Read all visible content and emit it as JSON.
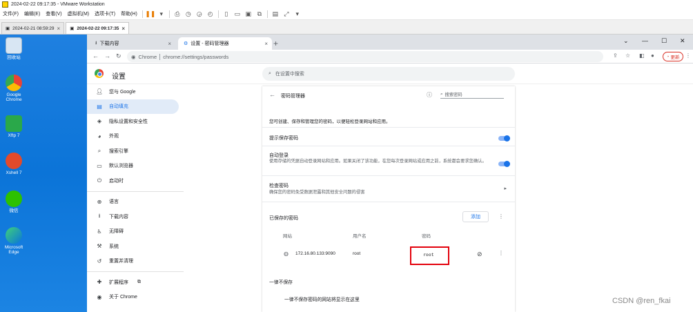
{
  "vm": {
    "title": "2024-02-22 09:17:35 - VMware Workstation",
    "menu": [
      "文件(F)",
      "编辑(E)",
      "查看(V)",
      "虚拟机(M)",
      "选项卡(T)",
      "帮助(H)"
    ],
    "tabs": [
      "2024-02-21 08:59:29",
      "2024-02-22 09:17:35"
    ]
  },
  "desktop": {
    "icons": [
      "回收站",
      "Google Chrome",
      "Xftp 7",
      "Xshell 7",
      "微信",
      "Microsoft Edge"
    ]
  },
  "chrome": {
    "tabs": [
      "下载内容",
      "设置 - 密码管理器"
    ],
    "address_label": "Chrome",
    "url": "chrome://settings/passwords",
    "update_label": "更新"
  },
  "settings": {
    "title": "设置",
    "search_placeholder": "在设置中搜索",
    "sidebar": [
      {
        "label": "您与 Google",
        "icon": "person-icon"
      },
      {
        "label": "自动填充",
        "icon": "autofill-icon"
      },
      {
        "label": "隐私设置和安全性",
        "icon": "shield-icon"
      },
      {
        "label": "外观",
        "icon": "palette-icon"
      },
      {
        "label": "搜索引擎",
        "icon": "search-icon"
      },
      {
        "label": "默认浏览器",
        "icon": "browser-icon"
      },
      {
        "label": "启动时",
        "icon": "power-icon"
      },
      {
        "label": "语言",
        "icon": "globe-icon"
      },
      {
        "label": "下载内容",
        "icon": "download-icon"
      },
      {
        "label": "无障碍",
        "icon": "accessibility-icon"
      },
      {
        "label": "系统",
        "icon": "wrench-icon"
      },
      {
        "label": "重置并清理",
        "icon": "reset-icon"
      },
      {
        "label": "扩展程序",
        "icon": "puzzle-icon"
      },
      {
        "label": "关于 Chrome",
        "icon": "chrome-icon"
      }
    ],
    "active_item": "自动填充"
  },
  "password_manager": {
    "title": "密码管理器",
    "search_placeholder": "搜索密码",
    "intro": "您可创建、保存和管理您的密码，以便轻松登录网站和应用。",
    "offer_save": "提示保存密码",
    "auto_signin_title": "自动登录",
    "auto_signin_desc": "使用存储的凭据自动登录网站和应用。如果关闭了该功能，在您每次登录网站或应用之前，系统都会要求您确认。",
    "check_title": "检查密码",
    "check_desc": "确保您的密码免受数据泄露和其他安全问题的侵害",
    "saved_title": "已保存的密码",
    "add_label": "添加",
    "columns": [
      "网站",
      "用户名",
      "密码"
    ],
    "entry": {
      "site": "172.16.80.133:9090",
      "username": "root",
      "password": "root"
    },
    "never_title": "一律不保存",
    "never_desc": "一律不保存密码的网站将显示在这里",
    "toggles": {
      "offer_save": true,
      "auto_signin": true
    }
  },
  "watermark": "CSDN @ren_fkai"
}
